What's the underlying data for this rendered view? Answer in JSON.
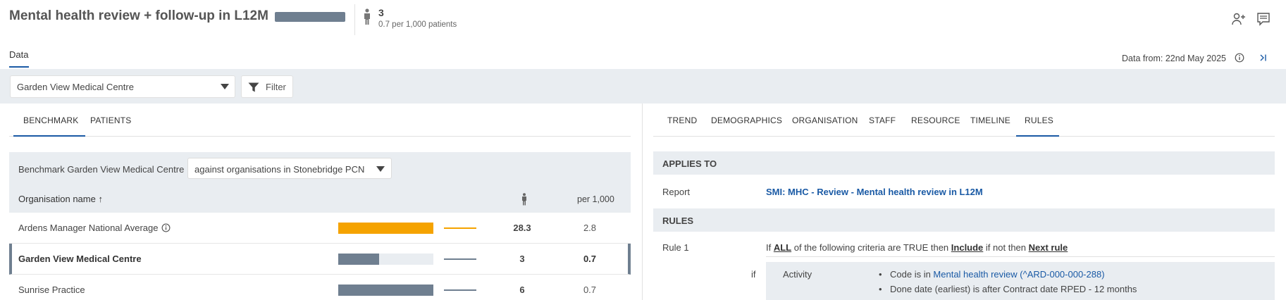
{
  "header": {
    "title": "Mental health review + follow-up in L12M",
    "count": "3",
    "count_sub": "0.7 per 1,000 patients"
  },
  "tabs": {
    "data": "Data"
  },
  "data_from": "Data from: 22nd May 2025",
  "filter": {
    "org_selected": "Garden View Medical Centre",
    "filter_label": "Filter"
  },
  "left_tabs": [
    {
      "label": "BENCHMARK",
      "active": true
    },
    {
      "label": "PATIENTS",
      "active": false
    }
  ],
  "benchmark": {
    "label": "Benchmark Garden View Medical Centre",
    "against": "against organisations in Stonebridge PCN",
    "col_org": "Organisation name ↑",
    "col_per1000": "per 1,000",
    "rows": [
      {
        "name": "Ardens Manager National Average",
        "count": "28.3",
        "rate": "2.8",
        "bar_fraction": 1.0,
        "color": "#f5a300",
        "selected": false
      },
      {
        "name": "Garden View Medical Centre",
        "count": "3",
        "rate": "0.7",
        "bar_fraction": 0.43,
        "color": "#6f7f90",
        "selected": true
      },
      {
        "name": "Sunrise Practice",
        "count": "6",
        "rate": "0.7",
        "bar_fraction": 1.0,
        "color": "#6f7f90",
        "selected": false
      }
    ]
  },
  "right_tabs": [
    {
      "label": "TREND",
      "active": false
    },
    {
      "label": "DEMOGRAPHICS",
      "active": false
    },
    {
      "label": "ORGANISATION",
      "active": false
    },
    {
      "label": "STAFF",
      "active": false
    },
    {
      "label": "RESOURCE",
      "active": false
    },
    {
      "label": "TIMELINE",
      "active": false
    },
    {
      "label": "RULES",
      "active": true
    }
  ],
  "rules": {
    "applies_to": "APPLIES TO",
    "report_label": "Report",
    "report_link": "SMI: MHC - Review - Mental health review in L12M",
    "rules_head": "RULES",
    "rule1_label": "Rule 1",
    "rule1_prefix": "If ",
    "rule1_all": "ALL",
    "rule1_mid": " of the following criteria are TRUE then ",
    "rule1_include": "Include",
    "rule1_mid2": " if not then ",
    "rule1_next": "Next rule",
    "if_label": "if",
    "criteria_type": "Activity",
    "criteria_1_prefix": "Code is in ",
    "criteria_1_link": "Mental health review (^ARD-000-000-288)",
    "criteria_2": "Done date (earliest) is after Contract date RPED - 12 months"
  },
  "colors": {
    "accent": "#1a5aa5",
    "national": "#f5a300",
    "practice": "#6f7f90"
  }
}
